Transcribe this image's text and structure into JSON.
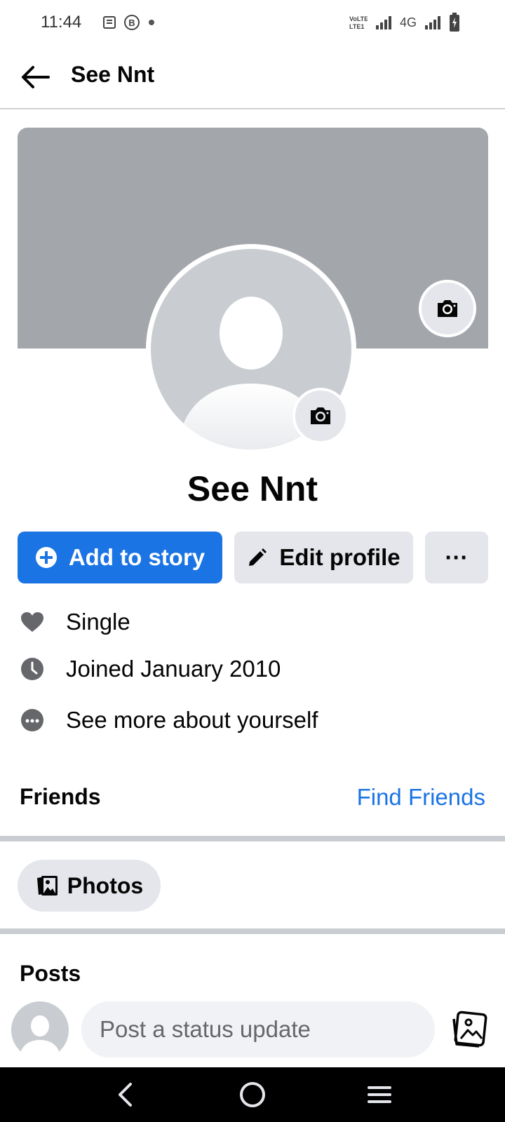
{
  "status_bar": {
    "time": "11:44",
    "right_text": "4G"
  },
  "header": {
    "title": "See Nnt"
  },
  "profile": {
    "name": "See Nnt"
  },
  "actions": {
    "add_story_label": "Add to story",
    "edit_profile_label": "Edit profile",
    "more_label": "···"
  },
  "info": {
    "relationship": "Single",
    "joined": "Joined January 2010",
    "see_more": "See more about yourself"
  },
  "friends": {
    "title": "Friends",
    "find_label": "Find Friends"
  },
  "photos": {
    "label": "Photos"
  },
  "posts": {
    "title": "Posts",
    "composer_placeholder": "Post a status update"
  },
  "colors": {
    "accent": "#1b74e4",
    "cover": "#a3a6ab",
    "button_gray": "#e4e6eb"
  }
}
